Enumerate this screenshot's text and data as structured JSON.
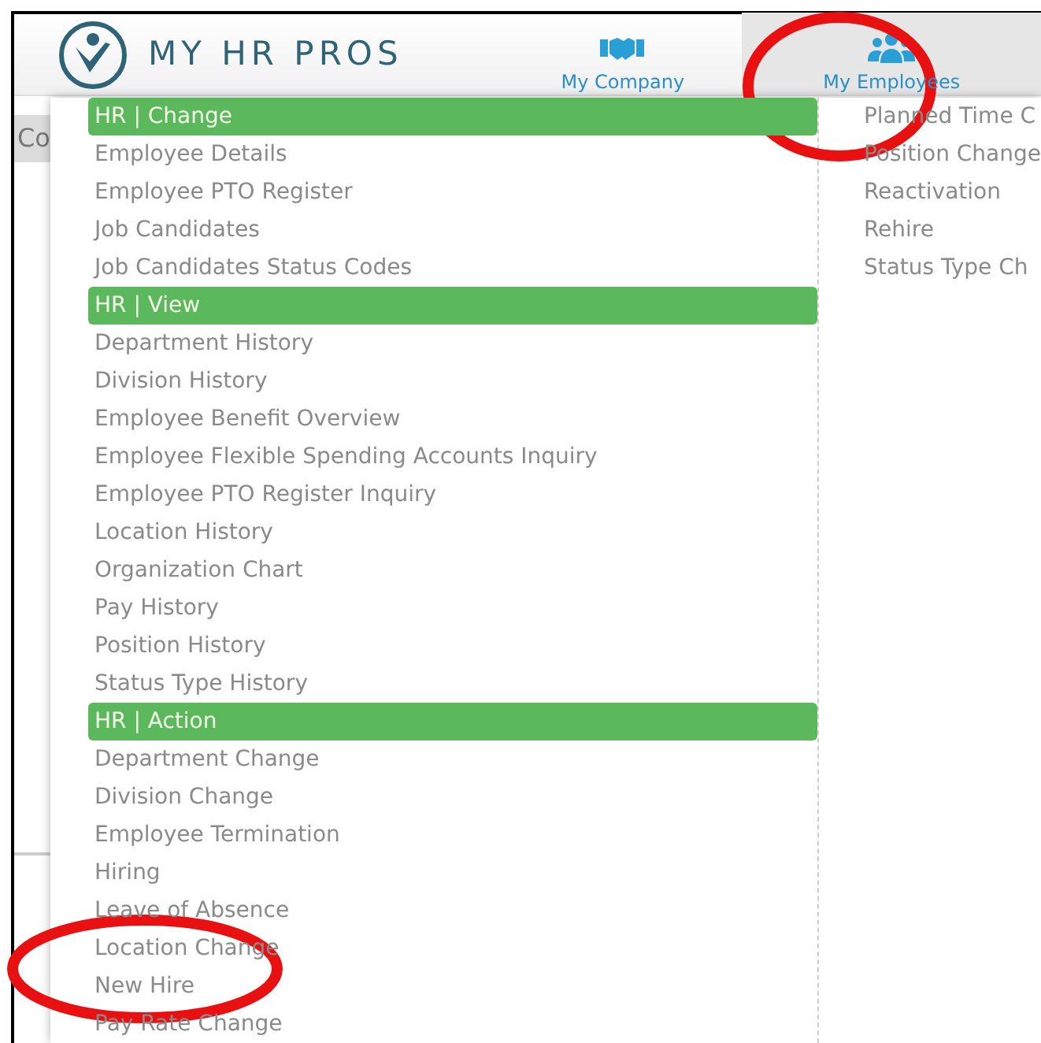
{
  "header": {
    "logo_text": "MY HR PROS",
    "nav": [
      {
        "label": "My Company",
        "selected": false
      },
      {
        "label": "My Employees",
        "selected": true
      }
    ]
  },
  "background": {
    "tab_text": "Co"
  },
  "menu": {
    "columns": [
      {
        "sections": [
          {
            "title": "HR | Change",
            "items": [
              "Employee Details",
              "Employee PTO Register",
              "Job Candidates",
              "Job Candidates Status Codes"
            ]
          },
          {
            "title": "HR | View",
            "items": [
              "Department History",
              "Division History",
              "Employee Benefit Overview",
              "Employee Flexible Spending Accounts Inquiry",
              "Employee PTO Register Inquiry",
              "Location History",
              "Organization Chart",
              "Pay History",
              "Position History",
              "Status Type History"
            ]
          },
          {
            "title": "HR | Action",
            "items": [
              "Department Change",
              "Division Change",
              "Employee Termination",
              "Hiring",
              "Leave of Absence",
              "Location Change",
              "New Hire",
              "Pay Rate Change"
            ]
          }
        ]
      },
      {
        "sections": [
          {
            "items": [
              "Planned Time C",
              "Position Change",
              "Reactivation",
              "Rehire",
              "Status Type Ch"
            ]
          }
        ]
      }
    ]
  }
}
